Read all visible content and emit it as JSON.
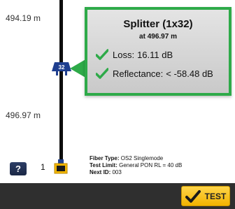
{
  "trace": {
    "top_distance": "494.19 m",
    "bottom_distance": "496.97 m",
    "splitter_badge": "32",
    "port_number": "1"
  },
  "event": {
    "title": "Splitter (1x32)",
    "subtitle": "at 496.97 m",
    "loss_label": "Loss:",
    "loss_value": "16.11 dB",
    "reflectance_label": "Reflectance:",
    "reflectance_value": "< -58.48 dB"
  },
  "fiber_info": {
    "type_label": "Fiber Type:",
    "type_value": "OS2 Singlemode",
    "limit_label": "Test Limit:",
    "limit_value": "General PON RL = 40 dB",
    "next_label": "Next ID:",
    "next_value": "003"
  },
  "controls": {
    "help_label": "?",
    "test_label": "TEST"
  },
  "colors": {
    "pass_green": "#2eaa49",
    "test_button": "#f5b800",
    "bottom_bar": "#2f2f2f"
  }
}
